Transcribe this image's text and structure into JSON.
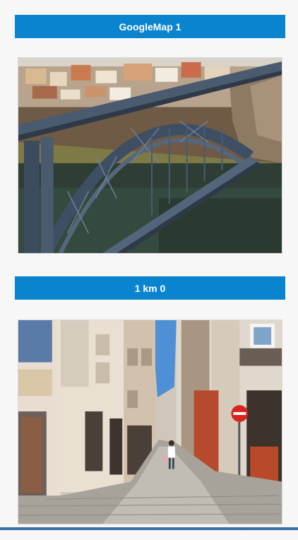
{
  "items": [
    {
      "title": "GoogleMap 1",
      "image": "porto-bridge-photo"
    },
    {
      "title": "1 km 0",
      "image": "narrow-street-photo"
    }
  ],
  "colors": {
    "accent": "#0b84d0",
    "background": "#f7f7f7"
  }
}
